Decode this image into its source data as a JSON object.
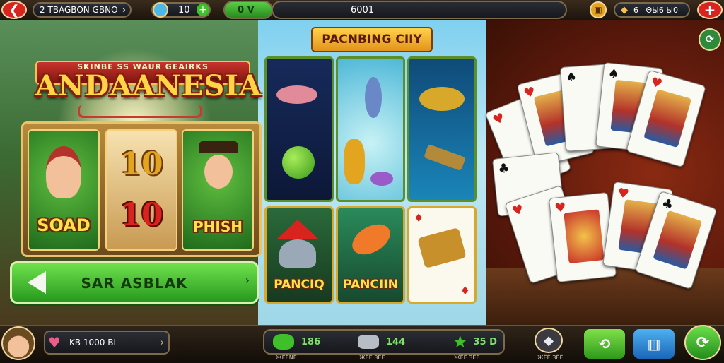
{
  "top_bar": {
    "player_label": "2 TBAGBON GBNO",
    "coins": "10",
    "level_badge": "0 V",
    "balance": "6001",
    "gems_label": "6   ΘЫ6 Ы0"
  },
  "left_game": {
    "subtitle": "SKINBE SS WAUR GEAIRKS",
    "title": "ANDAANESIA",
    "reels": [
      {
        "label": "SOAD"
      },
      {
        "numbers": [
          "10",
          "10"
        ]
      },
      {
        "label": "PHISH"
      }
    ],
    "spin_label": "SAR ASBLAK"
  },
  "middle_game": {
    "title": "PACNBING CIIY",
    "tiles": [
      {
        "label": ""
      },
      {
        "label": ""
      },
      {
        "label": ""
      },
      {
        "label": "PANCIQ"
      },
      {
        "label": "PANCIIN"
      },
      {
        "label": ""
      }
    ]
  },
  "cards": [
    {
      "suit": "♥"
    },
    {
      "suit": "♥"
    },
    {
      "suit": "♠"
    },
    {
      "suit": "♠"
    },
    {
      "suit": "♥"
    },
    {
      "suit": "♣"
    },
    {
      "suit": "♥"
    },
    {
      "suit": "♥"
    },
    {
      "suit": "♥"
    },
    {
      "suit": "♣"
    }
  ],
  "bottom_bar": {
    "player_name": "KB 1000 BI",
    "stats": [
      {
        "value": "186",
        "caption": "ЖЁЁNЁ"
      },
      {
        "value": "144",
        "caption": "ЖЁЁ ЗЁЁ"
      },
      {
        "value": "35 D",
        "caption": "ЖЁЁ ЗЁЁ"
      }
    ],
    "gem_caption": "ЖЁЁ ЗЁЁ"
  },
  "colors": {
    "accent_green": "#3fbf2a",
    "accent_red": "#d8231f",
    "gold": "#ffd445"
  }
}
